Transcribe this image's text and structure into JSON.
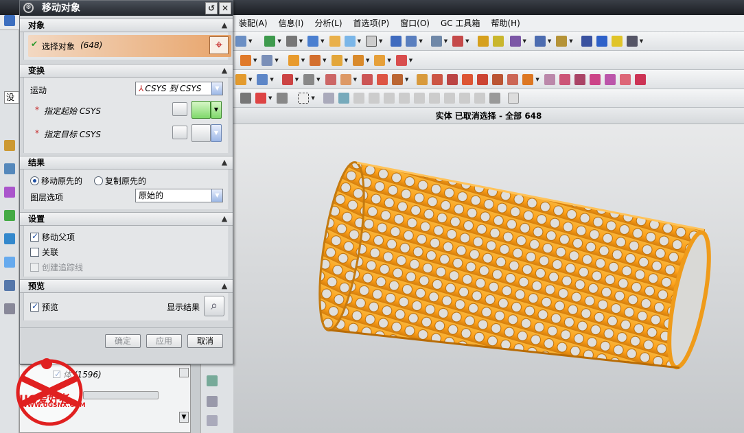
{
  "dialog": {
    "title": "移动对象",
    "sections": {
      "object": {
        "header": "对象",
        "select_label": "选择对象",
        "select_count": "(648)"
      },
      "transform": {
        "header": "变换",
        "motion_label": "运动",
        "motion_value": "CSYS 到 CSYS",
        "start_label": "指定起始 CSYS",
        "target_label": "指定目标 CSYS",
        "required_mark": "*"
      },
      "result": {
        "header": "结果",
        "move_original": "移动原先的",
        "copy_original": "复制原先的",
        "layer_label": "图层选项",
        "layer_value": "原始的",
        "move_original_selected": true
      },
      "settings": {
        "header": "设置",
        "move_parents": "移动父项",
        "move_parents_checked": true,
        "associative": "关联",
        "associative_checked": false,
        "create_trace": "创建追踪线",
        "create_trace_disabled": true
      },
      "preview": {
        "header": "预览",
        "preview_label": "预览",
        "preview_checked": true,
        "show_result": "显示结果"
      }
    },
    "buttons": {
      "ok": "确定",
      "apply": "应用",
      "cancel": "取消"
    }
  },
  "menubar": {
    "items": [
      "装配(A)",
      "信息(I)",
      "分析(L)",
      "首选项(P)",
      "窗口(O)",
      "GC 工具箱",
      "帮助(H)"
    ]
  },
  "statusbar": {
    "text": "实体 已取消选择 - 全部 648"
  },
  "left_fragment": {
    "toolbar_text": "没",
    "tree_item": "体 (1596)"
  },
  "watermark": {
    "brand": "UG爱好者",
    "url": "WWW.UGSNX.COM"
  },
  "colors": {
    "model": "#ffa21a",
    "select_bar": "#e8a46a",
    "accent_blue": "#1e4fa3"
  }
}
